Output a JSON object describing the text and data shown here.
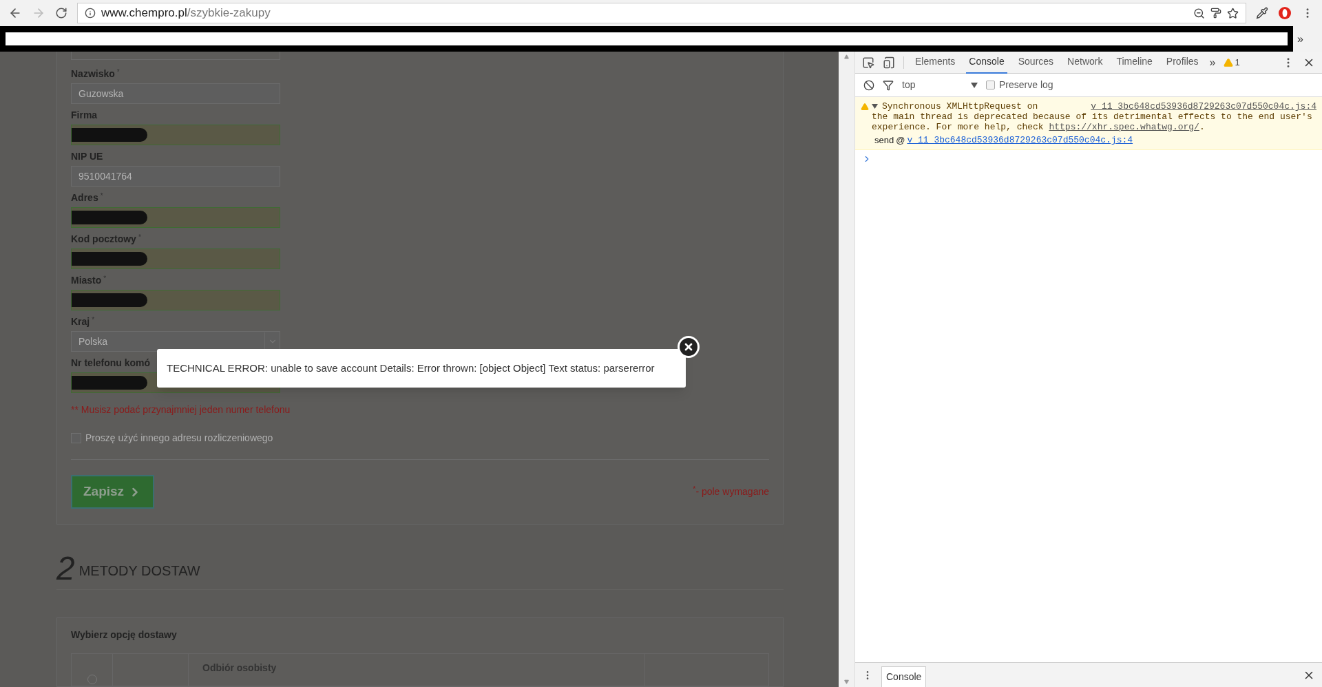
{
  "browser": {
    "back": {
      "disabled": false
    },
    "forward": {
      "disabled": true
    },
    "url_host": "www.chempro.pl",
    "url_path": "/szybkie-zakupy",
    "bookmarks_overflow": "»"
  },
  "form": {
    "fields": [
      {
        "label": "Nazwisko",
        "mark": "*",
        "kind": "text",
        "value": "Guzowska",
        "highlighted": false,
        "redacted": false
      },
      {
        "label": "Firma",
        "kind": "text",
        "highlighted": true,
        "redacted": true
      },
      {
        "label": "NIP UE",
        "kind": "text",
        "value": "9510041764",
        "highlighted": false,
        "redacted": false
      },
      {
        "label": "Adres",
        "mark": "*",
        "kind": "text",
        "highlighted": true,
        "redacted": true
      },
      {
        "label": "Kod pocztowy",
        "mark": "*",
        "kind": "text",
        "highlighted": true,
        "redacted": true
      },
      {
        "label": "Miasto",
        "mark": "*",
        "kind": "text",
        "highlighted": true,
        "redacted": true
      },
      {
        "label": "Kraj",
        "mark": "*",
        "kind": "select",
        "value": "Polska",
        "highlighted": false,
        "redacted": false
      },
      {
        "label": "Nr telefonu komó",
        "kind": "text",
        "highlighted": true,
        "redacted": true
      }
    ],
    "phone_note": "** Musisz podać przynajmniej jeden numer telefonu",
    "billing_checkbox": {
      "label": "Proszę użyć innego adresu rozliczeniowego",
      "checked": false
    },
    "save_button": "Zapisz",
    "required_note": "$^{*}$- pole wymagane"
  },
  "section": {
    "number": "2",
    "title": "METODY DOSTAW"
  },
  "delivery": {
    "title": "Wybierz opcję dostawy",
    "options": [
      {
        "name": "Odbiór osobisty",
        "selected": false
      }
    ]
  },
  "modal": {
    "message": "TECHNICAL ERROR: unable to save account Details: Error thrown: [object Object] Text status: parsererror"
  },
  "devtools": {
    "tabs": [
      {
        "label": "Elements",
        "selected": false
      },
      {
        "label": "Console",
        "selected": true
      },
      {
        "label": "Sources",
        "selected": false
      },
      {
        "label": "Network",
        "selected": false
      },
      {
        "label": "Timeline",
        "selected": false
      },
      {
        "label": "Profiles",
        "selected": false
      }
    ],
    "more": "»",
    "warning_count": "1",
    "context": "top",
    "preserve_log": {
      "label": "Preserve log",
      "checked": false
    },
    "messages": [
      {
        "kind": "warning",
        "expanded": true,
        "source": "v_11_3bc648cd53936d8729263c07d550c04c.js:4",
        "text": "Synchronous XMLHttpRequest on",
        "text_continued": "the main thread is deprecated because of its detrimental effects to the end user's experience. For more help, check",
        "link": "https://xhr.spec.whatwg.org/",
        "end": ".",
        "stack_fn": "send",
        "stack_at": "@",
        "stack_link": "v_11_3bc648cd53936d8729263c07d550c04c.js:4"
      }
    ],
    "drawer_tab": "Console"
  }
}
